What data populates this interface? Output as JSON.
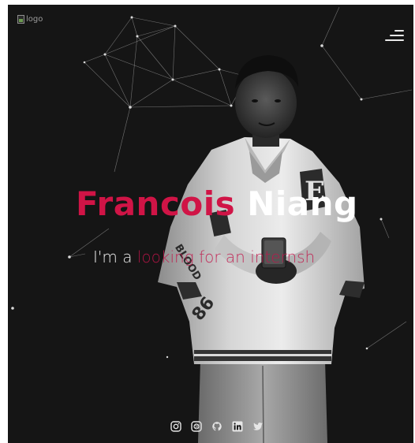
{
  "header": {
    "logo_alt": "logo",
    "menu_icon": "hamburger-icon"
  },
  "hero": {
    "first_name": "Francois",
    "last_name": "Niang",
    "tagline_prefix": "I'm a",
    "tagline_typed": "looking for an internsh"
  },
  "socials": [
    {
      "icon": "instagram-icon"
    },
    {
      "icon": "dribbble-icon"
    },
    {
      "icon": "github-icon"
    },
    {
      "icon": "linkedin-icon"
    },
    {
      "icon": "twitter-icon"
    }
  ],
  "colors": {
    "background": "#151515",
    "accent": "#d01446",
    "text": "#ffffff"
  }
}
